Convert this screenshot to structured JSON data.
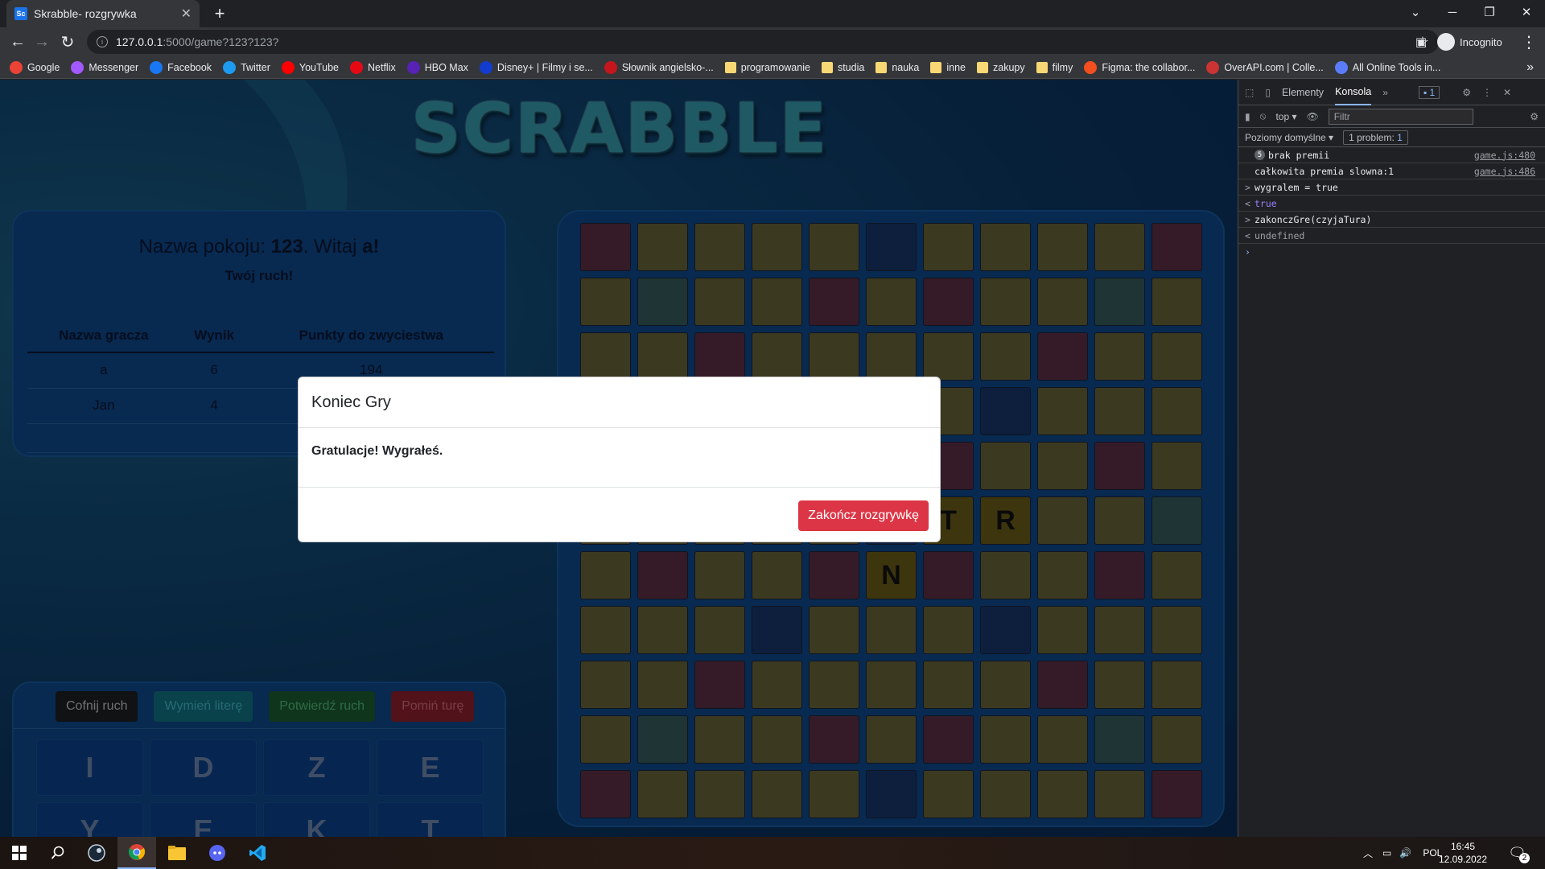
{
  "browser": {
    "tab_title": "Skrabble- rozgrywka",
    "tab_favicon": "Sc",
    "url_host": "127.0.0.1",
    "url_path": ":5000/game?123?123?",
    "profile_label": "Incognito",
    "bookmarks": [
      {
        "label": "Google",
        "color": "#ea4335"
      },
      {
        "label": "Messenger",
        "color": "#a259ff"
      },
      {
        "label": "Facebook",
        "color": "#1877f2"
      },
      {
        "label": "Twitter",
        "color": "#1d9bf0"
      },
      {
        "label": "YouTube",
        "color": "#ff0000"
      },
      {
        "label": "Netflix",
        "color": "#e50914"
      },
      {
        "label": "HBO Max",
        "color": "#5822b4"
      },
      {
        "label": "Disney+ | Filmy i se...",
        "color": "#113ccf"
      },
      {
        "label": "Słownik angielsko-...",
        "color": "#c4161c"
      },
      {
        "label": "programowanie",
        "folder": true
      },
      {
        "label": "studia",
        "folder": true
      },
      {
        "label": "nauka",
        "folder": true
      },
      {
        "label": "inne",
        "folder": true
      },
      {
        "label": "zakupy",
        "folder": true
      },
      {
        "label": "filmy",
        "folder": true
      },
      {
        "label": "Figma: the collabor...",
        "color": "#f24e1e"
      },
      {
        "label": "OverAPI.com | Colle...",
        "color": "#cc3333"
      },
      {
        "label": "All Online Tools in...",
        "color": "#5b7cfa"
      }
    ]
  },
  "game": {
    "logo_text": "SCRABBLE",
    "room_prefix": "Nazwa pokoju: ",
    "room_name": "123",
    "welcome_prefix": ". Witaj ",
    "player_name": "a",
    "welcome_suffix": "!",
    "turn_text": "Twój ruch!",
    "score_headers": [
      "Nazwa gracza",
      "Wynik",
      "Punkty do zwyciestwa"
    ],
    "scores": [
      {
        "name": "a",
        "score": "6",
        "to_win": "194"
      },
      {
        "name": "Jan",
        "score": "4",
        "to_win": ""
      }
    ],
    "buttons": {
      "undo": "Cofnij ruch",
      "exchange": "Wymień literę",
      "confirm": "Potwierdź ruch",
      "skip": "Pomiń turę"
    },
    "rack": [
      "I",
      "D",
      "Z",
      "E",
      "Y",
      "E",
      "K",
      "T"
    ],
    "board_colors": {
      "n": "#767340",
      "r": "#6a3650",
      "t": "#3e6a6a",
      "b": "#1c3e7a",
      "l": "#7a6a1a"
    },
    "board": [
      [
        "r",
        "n",
        "n",
        "n",
        "n",
        "b",
        "n",
        "n",
        "n",
        "n",
        "r"
      ],
      [
        "n",
        "t",
        "n",
        "n",
        "r",
        "n",
        "r",
        "n",
        "n",
        "t",
        "n"
      ],
      [
        "n",
        "n",
        "r",
        "n",
        "n",
        "n",
        "n",
        "n",
        "r",
        "n",
        "n"
      ],
      [
        "b",
        "n",
        "n",
        "n",
        "n",
        "n",
        "n",
        "b",
        "n",
        "n",
        "n"
      ],
      [
        "n",
        "n",
        "n",
        "n",
        "r",
        "n",
        "r",
        "n",
        "n",
        "r",
        "n"
      ],
      [
        "n",
        "n",
        "n",
        "n",
        "n",
        "b",
        "l",
        "l",
        "n",
        "n",
        "t"
      ],
      [
        "n",
        "r",
        "n",
        "n",
        "r",
        "l",
        "r",
        "n",
        "n",
        "r",
        "n"
      ],
      [
        "n",
        "n",
        "n",
        "b",
        "n",
        "n",
        "n",
        "b",
        "n",
        "n",
        "n"
      ],
      [
        "n",
        "n",
        "r",
        "n",
        "n",
        "n",
        "n",
        "n",
        "r",
        "n",
        "n"
      ],
      [
        "n",
        "t",
        "n",
        "n",
        "r",
        "n",
        "r",
        "n",
        "n",
        "t",
        "n"
      ],
      [
        "r",
        "n",
        "n",
        "n",
        "n",
        "b",
        "n",
        "n",
        "n",
        "n",
        "r"
      ]
    ],
    "board_letters": [
      {
        "row": 5,
        "col": 6,
        "letter": "T"
      },
      {
        "row": 5,
        "col": 7,
        "letter": "R"
      },
      {
        "row": 6,
        "col": 5,
        "letter": "N"
      }
    ]
  },
  "modal": {
    "title": "Koniec Gry",
    "body": "Gratulacje! Wygrałeś.",
    "end_button": "Zakończ rozgrywkę"
  },
  "devtools": {
    "tabs": [
      "Elementy",
      "Konsola"
    ],
    "active_tab": "Konsola",
    "badge": "1",
    "context": "top",
    "filter_placeholder": "Filtr",
    "levels": "Poziomy domyślne",
    "issues": "1 problem:",
    "issues_count": "1",
    "console": [
      {
        "prefix": "",
        "count": "5",
        "text": "brak premii",
        "src": "game.js:480",
        "color": "#e8eaed"
      },
      {
        "prefix": "",
        "count": "",
        "text": "całkowita premia slowna:1",
        "src": "game.js:486",
        "color": "#e8eaed"
      },
      {
        "prefix": ">",
        "count": "",
        "text": "wygralem = true",
        "src": "",
        "color": "#e8eaed"
      },
      {
        "prefix": "<",
        "count": "",
        "text": "true",
        "src": "",
        "color": "#9980ff"
      },
      {
        "prefix": ">",
        "count": "",
        "text": "zakonczGre(czyjaTura)",
        "src": "",
        "color": "#e8eaed"
      },
      {
        "prefix": "<",
        "count": "",
        "text": "undefined",
        "src": "",
        "color": "#9aa0a6"
      }
    ]
  },
  "taskbar": {
    "language": "POL",
    "time": "16:45",
    "date": "12.09.2022",
    "notifications": "2"
  }
}
